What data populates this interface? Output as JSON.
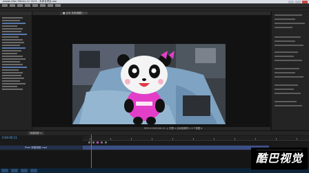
{
  "app": {
    "window_title": "Adobe After Effects CC 2015 - 未命名项目.aep"
  },
  "composition": {
    "tab_label": "■ 合成 熊猫视频",
    "tab2_label": "图层 (无)"
  },
  "viewer": {
    "zoom_label": "50% ▾   0:00:00:11   ◎ 完整 ▾   活动摄像机 ▾   1个视图 ▾"
  },
  "timeline": {
    "tab_label": "熊猫视频 ≡",
    "timecode": "0:00:00:11",
    "layer_name": "Pixel 熊猫视频.mp4"
  },
  "watermark": {
    "text": "酷巴视觉"
  },
  "colors": {
    "timecode": "#5ab0ff",
    "playhead": "#ff3b3b",
    "work_area": "#b04ac6",
    "track": "#3c4f85",
    "taskbar": "#0d2338",
    "panda_shirt": "#e23ec8"
  }
}
